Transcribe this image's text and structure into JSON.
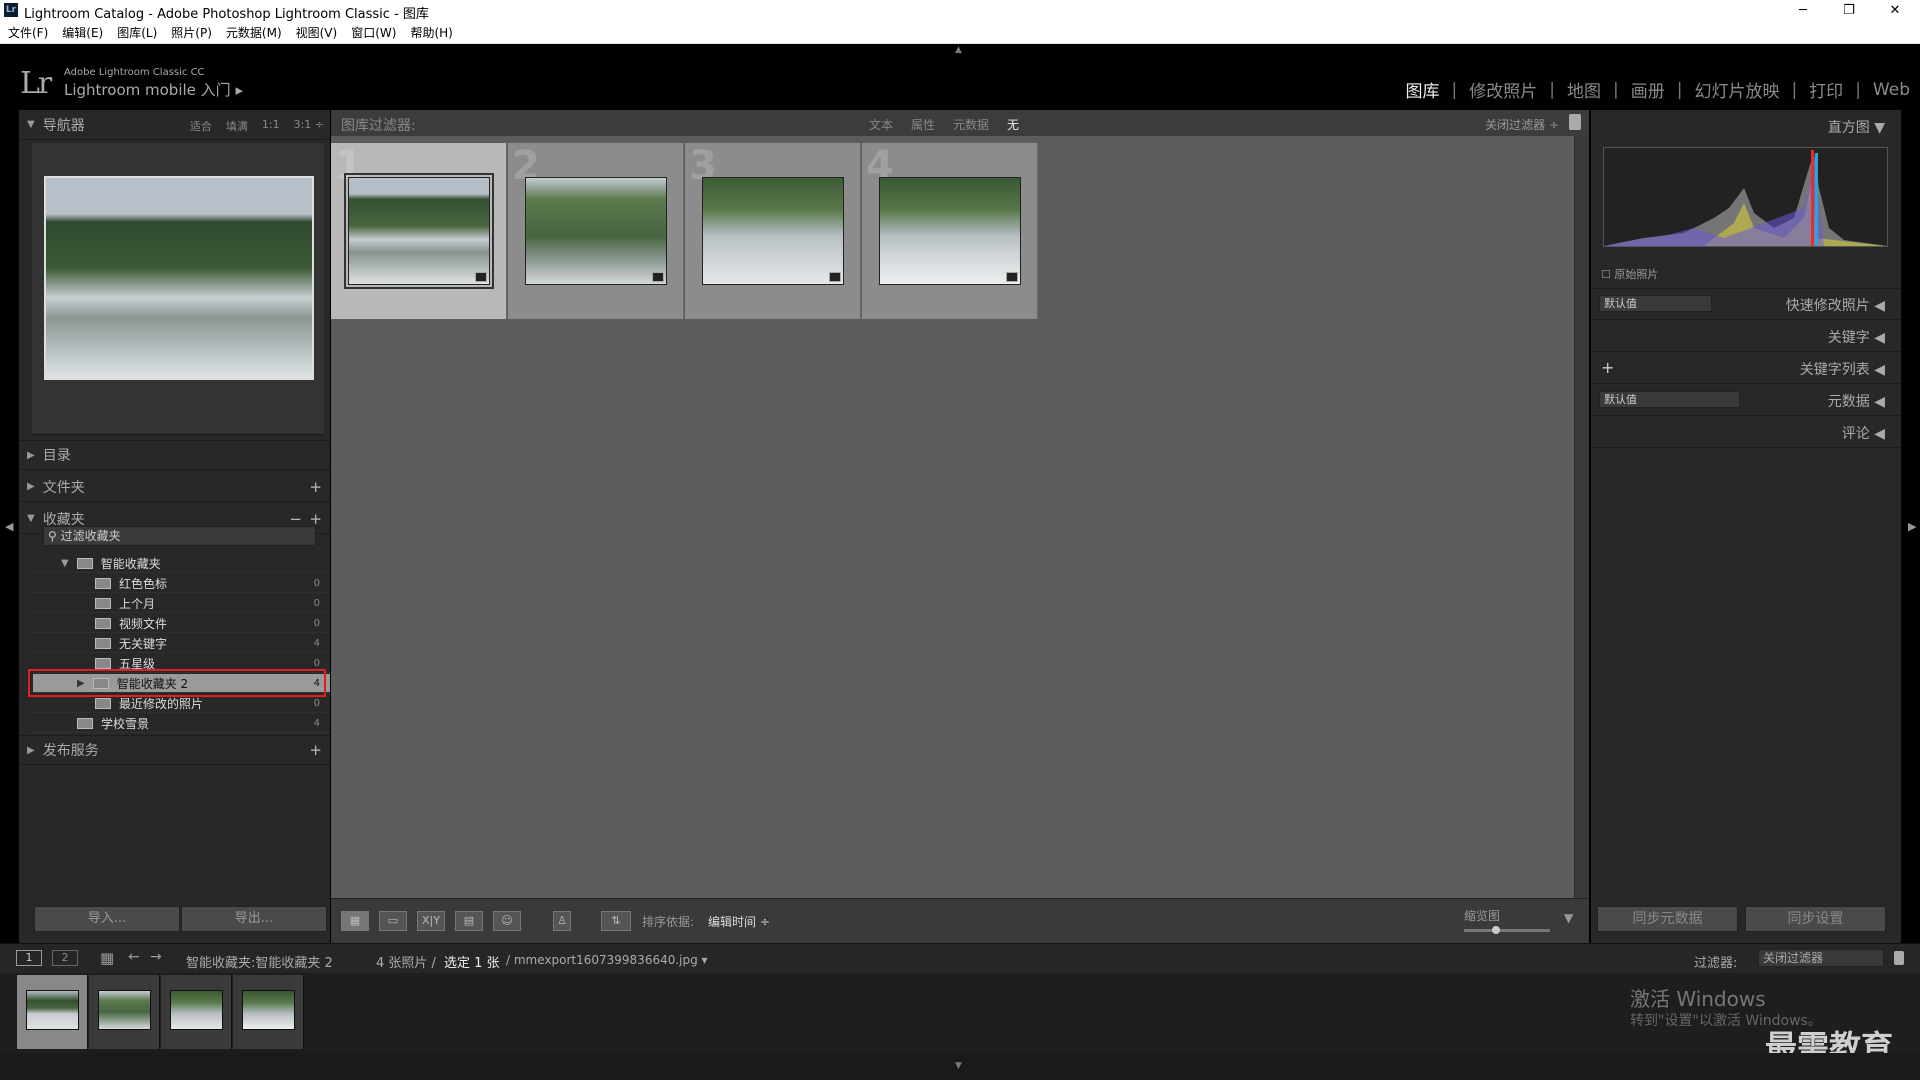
{
  "window": {
    "title": "Lightroom Catalog - Adobe Photoshop Lightroom Classic - 图库",
    "app_icon": "Lr",
    "controls": [
      "─",
      "❐",
      "✕"
    ]
  },
  "menu": [
    "文件(F)",
    "编辑(E)",
    "图库(L)",
    "照片(P)",
    "元数据(M)",
    "视图(V)",
    "窗口(W)",
    "帮助(H)"
  ],
  "identity": {
    "logo": "Lr",
    "product": "Adobe Lightroom Classic CC",
    "mobile": "Lightroom mobile 入门",
    "arrow": "▸"
  },
  "modules": [
    "图库",
    "修改照片",
    "地图",
    "画册",
    "幻灯片放映",
    "打印",
    "Web"
  ],
  "left": {
    "navigator": {
      "label": "导航器",
      "opts": [
        "适合",
        "填满",
        "1:1",
        "3:1 ÷"
      ]
    },
    "catalog": "目录",
    "folders": "文件夹",
    "collections": "收藏夹",
    "filter_placeholder": "过滤收藏夹",
    "smart_collections": "智能收藏夹",
    "items": [
      {
        "label": "红色色标",
        "count": "0"
      },
      {
        "label": "上个月",
        "count": "0"
      },
      {
        "label": "视频文件",
        "count": "0"
      },
      {
        "label": "无关键字",
        "count": "4"
      },
      {
        "label": "五星级",
        "count": "0"
      },
      {
        "label": "智能收藏夹 2",
        "count": "4"
      },
      {
        "label": "最近修改的照片",
        "count": "0"
      }
    ],
    "school": {
      "label": "学校雪景",
      "count": "4"
    },
    "publish": "发布服务",
    "import_btn": "导入...",
    "export_btn": "导出..."
  },
  "filterbar": {
    "label": "图库过滤器:",
    "options": [
      "文本",
      "属性",
      "元数据",
      "无"
    ],
    "close": "关闭过滤器 ÷"
  },
  "grid": {
    "cells": [
      "1",
      "2",
      "3",
      "4"
    ]
  },
  "toolbar": {
    "sort_label": "排序依据:",
    "sort_value": "编辑时间 ÷",
    "thumb_label": "缩览图",
    "xy": "X|Y"
  },
  "right": {
    "histogram": "直方图",
    "original": "原始照片",
    "quick_develop": "快速修改照片",
    "default1": "默认值",
    "keywording": "关键字",
    "keyword_list": "关键字列表",
    "metadata": "元数据",
    "default2": "默认值",
    "comments": "评论",
    "sync_meta": "同步元数据",
    "sync_settings": "同步设置"
  },
  "filmstrip": {
    "page1": "1",
    "page2": "2",
    "path": "智能收藏夹:智能收藏夹 2",
    "count": "4 张照片 /",
    "selected": "选定 1 张",
    "filename": "/ mmexport1607399836640.jpg ▾",
    "filter_label": "过滤器:",
    "filter_value": "关闭过滤器"
  },
  "watermark": {
    "activate": "激活 Windows",
    "hint": "转到\"设置\"以激活 Windows。",
    "brand": "最需教育"
  }
}
